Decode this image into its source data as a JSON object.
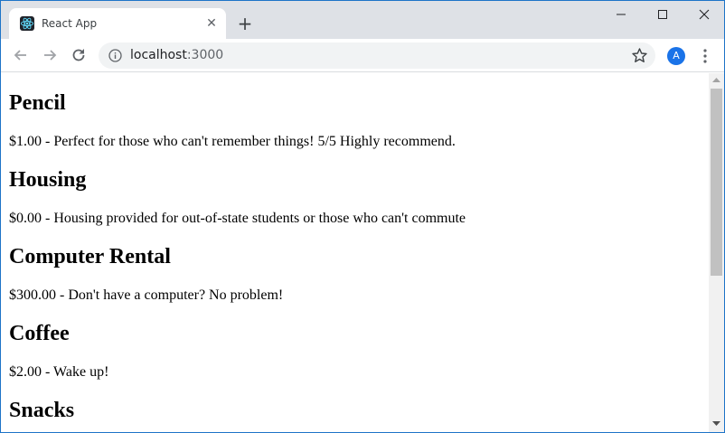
{
  "browser": {
    "tab_title": "React App",
    "tab_close": "✕",
    "new_tab": "+",
    "url_host": "localhost",
    "url_port": ":3000",
    "profile_initial": "A",
    "icons": {
      "favicon": "react-logo-icon",
      "back": "back-arrow-icon",
      "forward": "forward-arrow-icon",
      "reload": "reload-icon",
      "site_info": "info-icon",
      "bookmark": "star-icon",
      "menu": "kebab-menu-icon",
      "minimize": "minimize-icon",
      "maximize": "maximize-icon",
      "close": "close-icon"
    },
    "colors": {
      "frame": "#dee1e6",
      "accent": "#1a73e8",
      "window_border": "#1e74c8"
    }
  },
  "page": {
    "products": [
      {
        "name": "Pencil",
        "price": "$1.00",
        "description": "Perfect for those who can't remember things! 5/5 Highly recommend."
      },
      {
        "name": "Housing",
        "price": "$0.00",
        "description": "Housing provided for out-of-state students or those who can't commute"
      },
      {
        "name": "Computer Rental",
        "price": "$300.00",
        "description": "Don't have a computer? No problem!"
      },
      {
        "name": "Coffee",
        "price": "$2.00",
        "description": "Wake up!"
      },
      {
        "name": "Snacks",
        "price": "",
        "description": ""
      }
    ]
  }
}
